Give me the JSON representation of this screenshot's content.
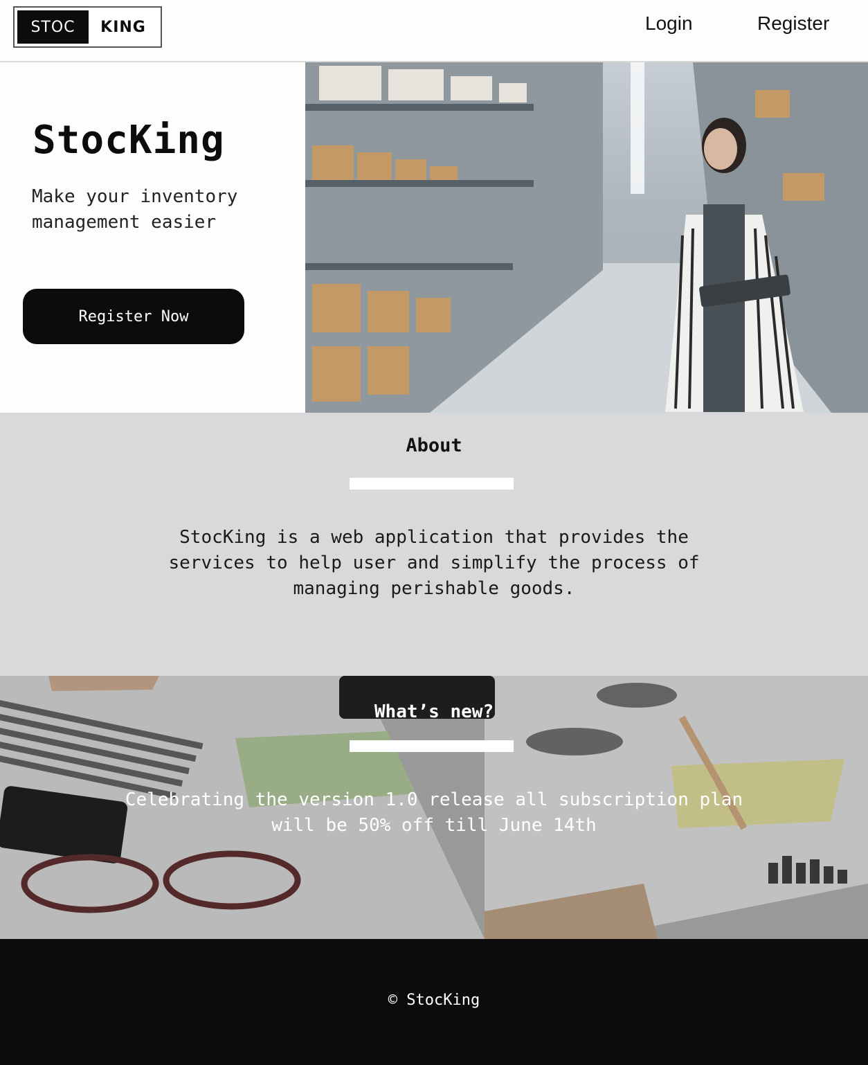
{
  "header": {
    "logo_left": "STOC",
    "logo_right": "KING",
    "nav": {
      "login": "Login",
      "register": "Register"
    }
  },
  "hero": {
    "title": "StocKing",
    "subtitle": "Make your inventory management easier",
    "cta": "Register Now"
  },
  "about": {
    "title": "About",
    "text": "StocKing is a web application that provides the services to help user and simplify the process of managing perishable goods."
  },
  "news": {
    "title": "What’s new?",
    "text": "Celebrating the version 1.0 release all subscription plan will be 50% off till June 14th"
  },
  "footer": {
    "copyright": "© StocKing"
  }
}
